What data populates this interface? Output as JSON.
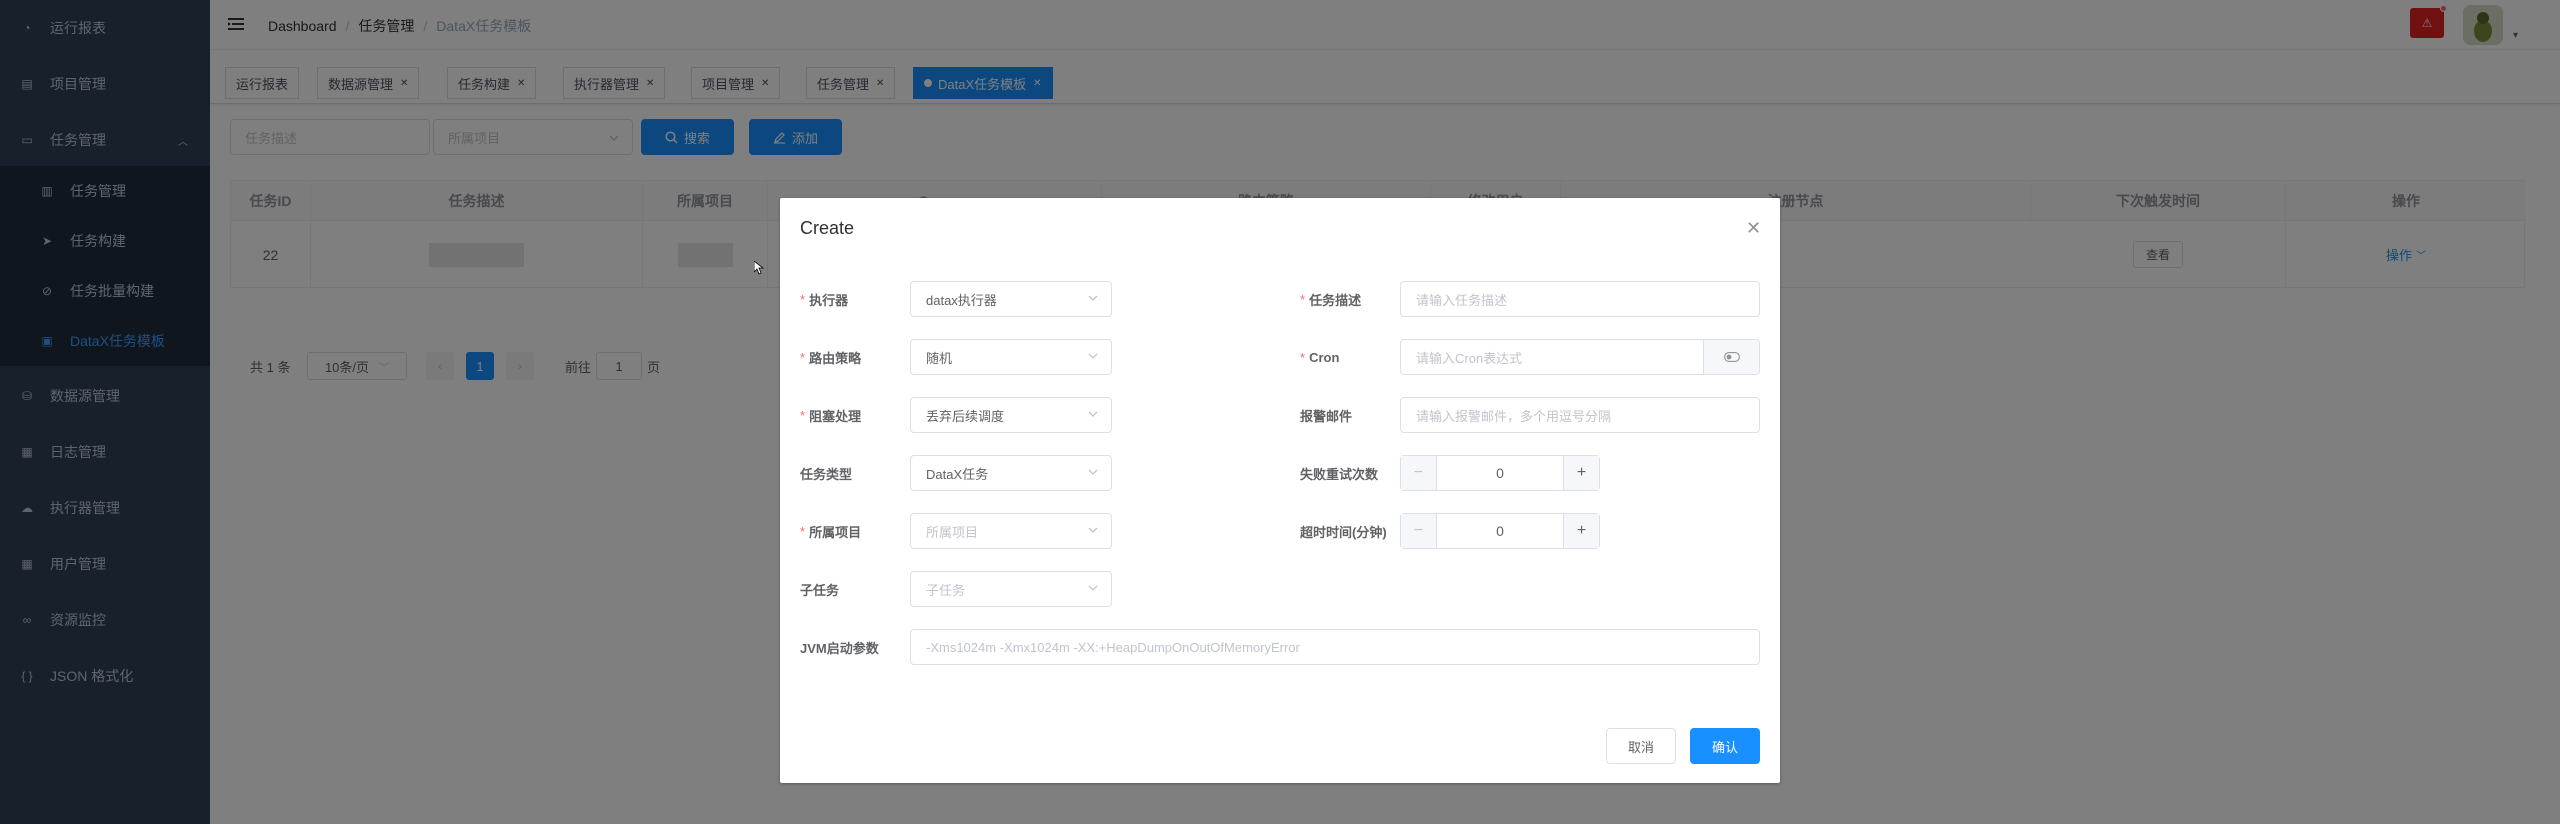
{
  "sidebar": {
    "items": [
      {
        "label": "运行报表",
        "icon": "dashboard-icon"
      },
      {
        "label": "项目管理",
        "icon": "list-icon"
      },
      {
        "label": "任务管理",
        "icon": "monitor-icon"
      },
      {
        "label": "任务管理",
        "icon": "document-icon"
      },
      {
        "label": "任务构建",
        "icon": "send-icon"
      },
      {
        "label": "任务批量构建",
        "icon": "compass-icon"
      },
      {
        "label": "DataX任务模板",
        "icon": "template-icon"
      },
      {
        "label": "数据源管理",
        "icon": "database-icon"
      },
      {
        "label": "日志管理",
        "icon": "log-icon"
      },
      {
        "label": "执行器管理",
        "icon": "cloud-icon"
      },
      {
        "label": "用户管理",
        "icon": "table-icon"
      },
      {
        "label": "资源监控",
        "icon": "monitor-eye-icon"
      },
      {
        "label": "JSON 格式化",
        "icon": "braces-icon"
      }
    ]
  },
  "navbar": {
    "breadcrumb": [
      "Dashboard",
      "任务管理",
      "DataX任务模板"
    ],
    "separator": "/"
  },
  "tags": [
    {
      "label": "运行报表",
      "closable": false
    },
    {
      "label": "数据源管理",
      "closable": true
    },
    {
      "label": "任务构建",
      "closable": true
    },
    {
      "label": "执行器管理",
      "closable": true
    },
    {
      "label": "项目管理",
      "closable": true
    },
    {
      "label": "任务管理",
      "closable": true
    },
    {
      "label": "DataX任务模板",
      "closable": true
    }
  ],
  "filter": {
    "desc_placeholder": "任务描述",
    "project_placeholder": "所属项目",
    "search_label": "搜索",
    "add_label": "添加"
  },
  "table": {
    "columns": [
      "任务ID",
      "任务描述",
      "所属项目",
      "Cron",
      "路由策略",
      "修改用户",
      "注册节点",
      "下次触发时间",
      "操作"
    ],
    "rows": [
      {
        "id": "22",
        "view": "查看",
        "action": "操作"
      }
    ]
  },
  "pagination": {
    "total": "共 1 条",
    "page_size": "10条/页",
    "current": "1",
    "goto_prefix": "前往",
    "goto_value": "1",
    "goto_suffix": "页"
  },
  "dialog": {
    "title": "Create",
    "fields": {
      "executor": {
        "label": "执行器",
        "value": "datax执行器"
      },
      "route": {
        "label": "路由策略",
        "value": "随机"
      },
      "block": {
        "label": "阻塞处理",
        "value": "丢弃后续调度"
      },
      "type": {
        "label": "任务类型",
        "value": "DataX任务"
      },
      "project": {
        "label": "所属项目",
        "placeholder": "所属项目"
      },
      "child": {
        "label": "子任务",
        "placeholder": "子任务"
      },
      "desc": {
        "label": "任务描述",
        "placeholder": "请输入任务描述"
      },
      "cron": {
        "label": "Cron",
        "placeholder": "请输入Cron表达式"
      },
      "alarm": {
        "label": "报警邮件",
        "placeholder": "请输入报警邮件，多个用逗号分隔"
      },
      "retry": {
        "label": "失败重试次数",
        "value": "0"
      },
      "timeout": {
        "label": "超时时间(分钟)",
        "value": "0"
      },
      "jvm": {
        "label": "JVM启动参数",
        "placeholder": "-Xms1024m -Xmx1024m -XX:+HeapDumpOnOutOfMemoryError"
      }
    },
    "cancel_label": "取消",
    "confirm_label": "确认"
  },
  "colors": {
    "sidebar_bg": "#304156",
    "primary": "#1890ff",
    "active_menu": "#409eff",
    "required": "#f56c6c"
  }
}
